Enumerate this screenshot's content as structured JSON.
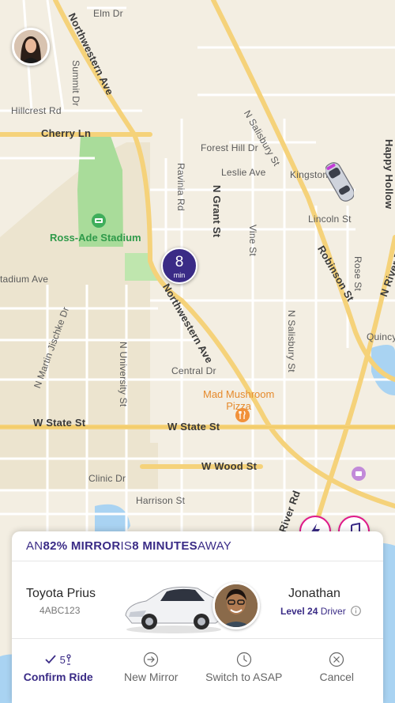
{
  "map": {
    "streets": {
      "elm_dr": "Elm Dr",
      "northwestern_ave_top": "Northwestern Ave",
      "summit_dr": "Summit Dr",
      "hillcrest_rd": "Hillcrest Rd",
      "n_salisbury_st_top": "N Salisbury St",
      "happy_hollow": "Happy Hollow",
      "cherry_ln": "Cherry Ln",
      "forest_hill_dr": "Forest Hill Dr",
      "leslie_ave": "Leslie Ave",
      "kingston": "Kingston",
      "ravinia_rd": "Ravinia Rd",
      "n_grant_st": "N Grant St",
      "vine_st": "Vine St",
      "lincoln_st": "Lincoln St",
      "robinson_st": "Robinson St",
      "rose_st": "Rose St",
      "n_river_rd_top": "N River R",
      "stadium_ave": "tadium Ave",
      "northwestern_ave_mid": "Northwestern Ave",
      "n_martin_jischke_dr": "N Martin Jischke Dr",
      "n_salisbury_st_mid": "N Salisbury St",
      "quincy": "Quincy",
      "central_dr": "Central Dr",
      "n_university_st": "N University St",
      "w_state_st_left": "W State St",
      "w_state_st_mid": "W State St",
      "w_wood_st": "W Wood St",
      "clinic_dr": "Clinic Dr",
      "harrison_st": "Harrison St",
      "n_river_rd_bottom": "River Rd"
    },
    "pois": {
      "stadium": "Ross-Ade Stadium",
      "pizza_line1": "Mad Mushroom",
      "pizza_line2": "Pizza"
    },
    "eta_pin": {
      "value": "8",
      "unit": "min"
    }
  },
  "header": {
    "prefix": "AN ",
    "percent": "82% MIRROR",
    "middle": " IS ",
    "minutes": "8 MINUTES",
    "suffix": " AWAY"
  },
  "vehicle": {
    "model": "Toyota Prius",
    "plate": "4ABC123"
  },
  "driver": {
    "name": "Jonathan",
    "level": "Level 24",
    "level_suffix": " Driver"
  },
  "actions": {
    "confirm": {
      "label": "Confirm Ride",
      "count": "5"
    },
    "new_mirror": {
      "label": "New Mirror"
    },
    "switch_asap": {
      "label": "Switch to ASAP"
    },
    "cancel": {
      "label": "Cancel"
    }
  },
  "colors": {
    "brand": "#3a2b86",
    "accent": "#e0198a",
    "park": "#a9dc9a",
    "water": "#a9d3f2",
    "road": "#f7d77a"
  },
  "icons": {
    "fab_left": "lightning-icon",
    "fab_right": "music-note-icon"
  }
}
